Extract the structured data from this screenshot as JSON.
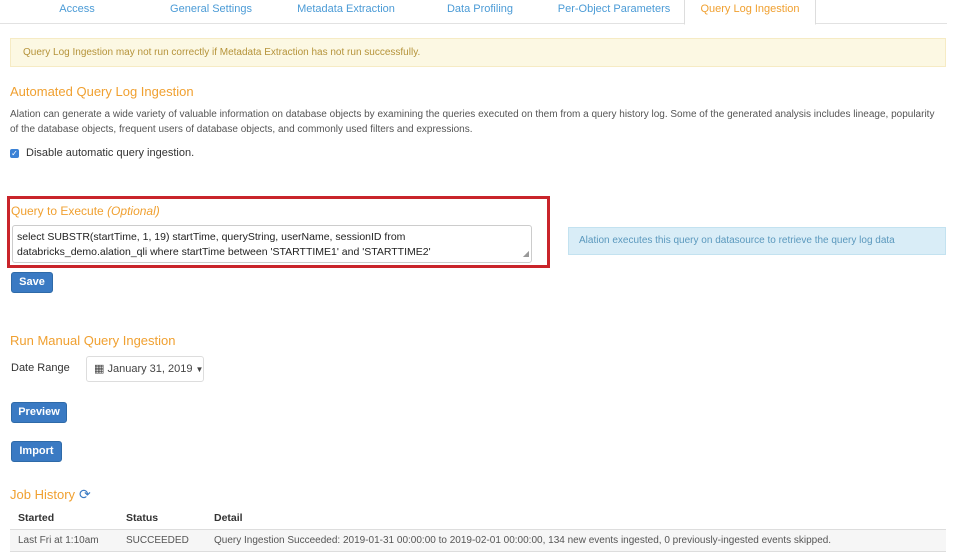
{
  "tabs": [
    {
      "label": "Access"
    },
    {
      "label": "General Settings"
    },
    {
      "label": "Metadata Extraction"
    },
    {
      "label": "Data Profiling"
    },
    {
      "label": "Per-Object Parameters"
    },
    {
      "label": "Query Log Ingestion",
      "active": true
    }
  ],
  "warning": "Query Log Ingestion may not run correctly if Metadata Extraction has not run successfully.",
  "auto": {
    "title": "Automated Query Log Ingestion",
    "description": "Alation can generate a wide variety of valuable information on database objects by examining the queries executed on them from a query history log. Some of the generated analysis includes lineage, popularity of the database objects, frequent users of database objects, and commonly used filters and expressions.",
    "checkbox_label": "Disable automatic query ingestion.",
    "checkbox_checked": true
  },
  "query": {
    "label": "Query to Execute",
    "optional": "(Optional)",
    "text": "select SUBSTR(startTime, 1, 19) startTime, queryString, userName, sessionID from databricks_demo.alation_qli where startTime between 'STARTTIME1' and 'STARTTIME2'",
    "info": "Alation executes this query on datasource to retrieve the query log data",
    "save_label": "Save"
  },
  "manual": {
    "title": "Run Manual Query Ingestion",
    "date_label": "Date Range",
    "date_value": "January 31, 2019",
    "preview_label": "Preview",
    "import_label": "Import"
  },
  "job_history": {
    "title": "Job History",
    "columns": [
      "Started",
      "Status",
      "Detail"
    ],
    "rows": [
      {
        "started": "Last Fri at 1:10am",
        "status": "SUCCEEDED",
        "detail": "Query Ingestion Succeeded: 2019-01-31 00:00:00 to 2019-02-01 00:00:00, 134 new events ingested, 0 previously-ingested events skipped."
      }
    ]
  },
  "icons": {
    "calendar": "calendar-icon",
    "caret": "caret-down-icon",
    "refresh": "refresh-icon",
    "check": "checkbox-checked-icon"
  },
  "colors": {
    "accent_orange": "#f0a030",
    "link_blue": "#4b9bd6",
    "button_blue": "#3a7ac3",
    "highlight_red": "#c9242a",
    "warning_bg": "#fcf8e3",
    "info_bg": "#d9edf7"
  }
}
